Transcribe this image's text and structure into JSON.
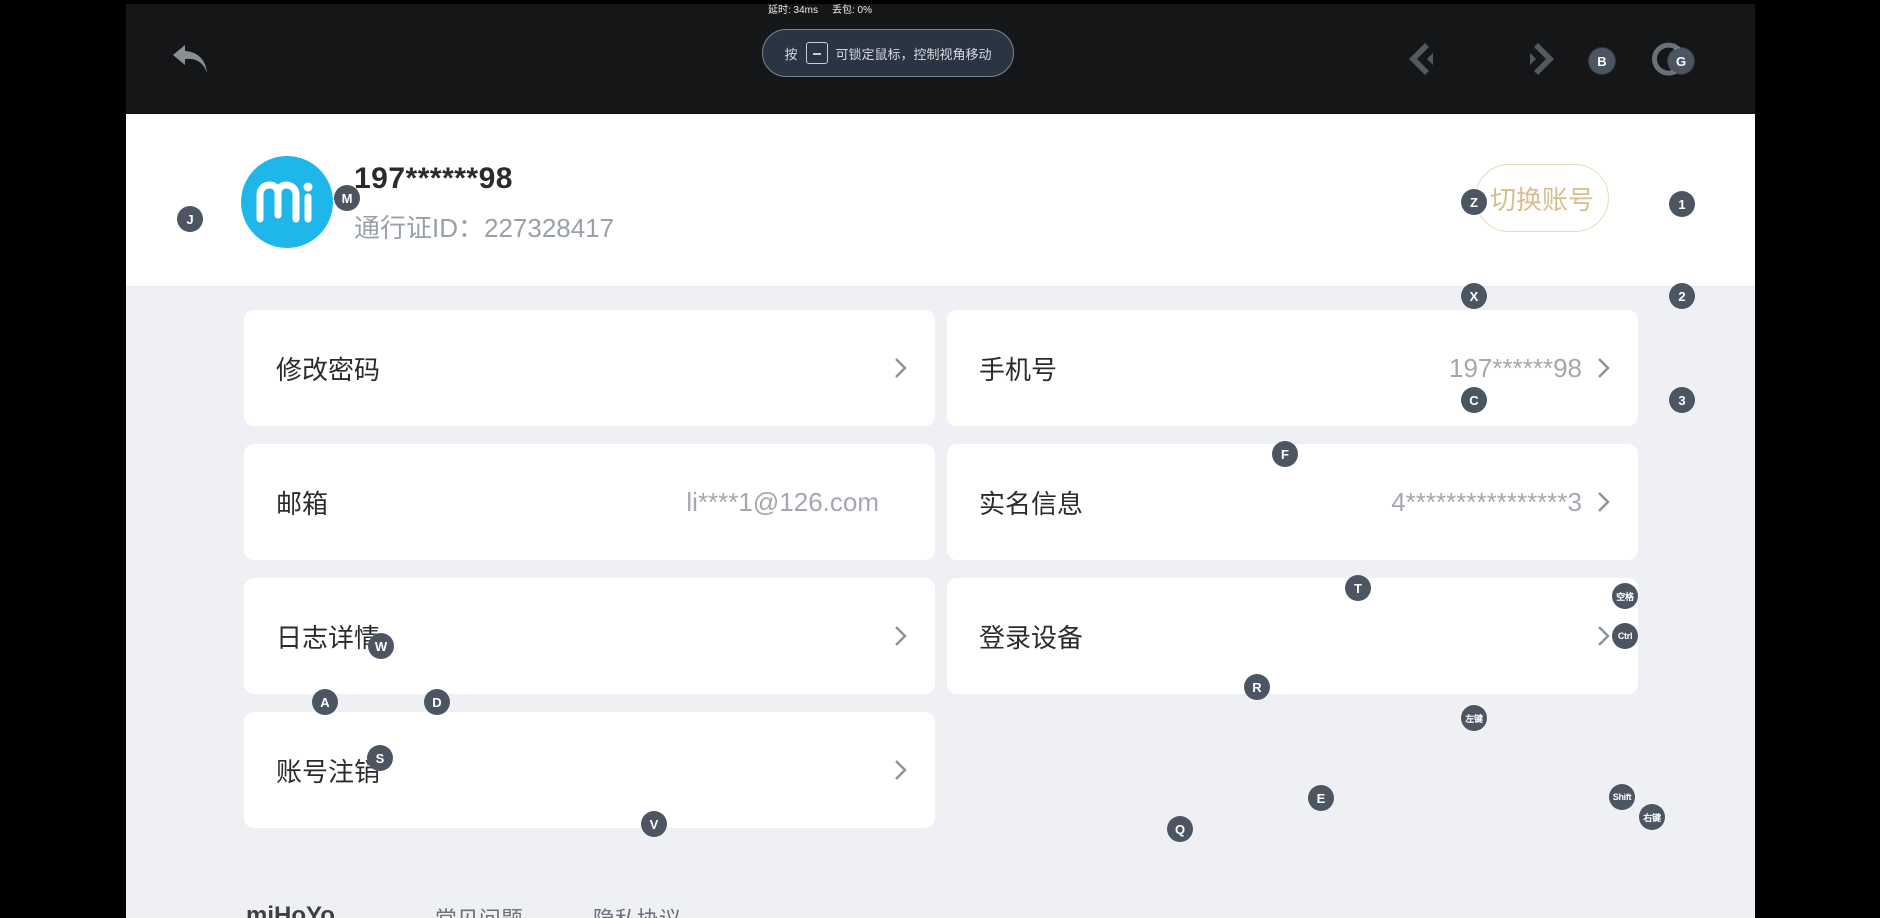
{
  "stats": {
    "latency": "延时: 34ms",
    "packet_loss": "丢包: 0%"
  },
  "toolbar": {
    "lock_hint_prefix": "按",
    "lock_hint_text": "可锁定鼠标，控制视角移动"
  },
  "profile": {
    "username": "197******98",
    "passport_id": "通行证ID：227328417",
    "switch_account": "切换账号"
  },
  "settings": [
    {
      "label": "修改密码",
      "value": "",
      "chevron": true
    },
    {
      "label": "手机号",
      "value": "197******98",
      "chevron": true
    },
    {
      "label": "邮箱",
      "value": "li****1@126.com",
      "chevron": false
    },
    {
      "label": "实名信息",
      "value": "4****************3",
      "chevron": true
    },
    {
      "label": "日志详情",
      "value": "",
      "chevron": true
    },
    {
      "label": "登录设备",
      "value": "",
      "chevron": true
    },
    {
      "label": "账号注销",
      "value": "",
      "chevron": true
    }
  ],
  "footer": {
    "logo": "miHoYo",
    "faq": "常见问题",
    "privacy": "隐私协议"
  },
  "keys": {
    "J": "J",
    "M": "M",
    "Z": "Z",
    "K1": "1",
    "X": "X",
    "K2": "2",
    "C": "C",
    "K3": "3",
    "F": "F",
    "T": "T",
    "SPACE": "空格",
    "CTRL": "Ctrl",
    "W": "W",
    "R": "R",
    "A": "A",
    "D": "D",
    "LEFT": "左键",
    "S": "S",
    "E": "E",
    "SHIFT": "Shift",
    "RIGHT": "右键",
    "V": "V",
    "Q": "Q",
    "B": "B",
    "G": "G"
  },
  "colors": {
    "toolbar_bg": "#151618",
    "avatar_bg": "#1fb7ea",
    "switch_account_accent": "#d7be8d",
    "key_marker_bg": "#4c5663"
  }
}
